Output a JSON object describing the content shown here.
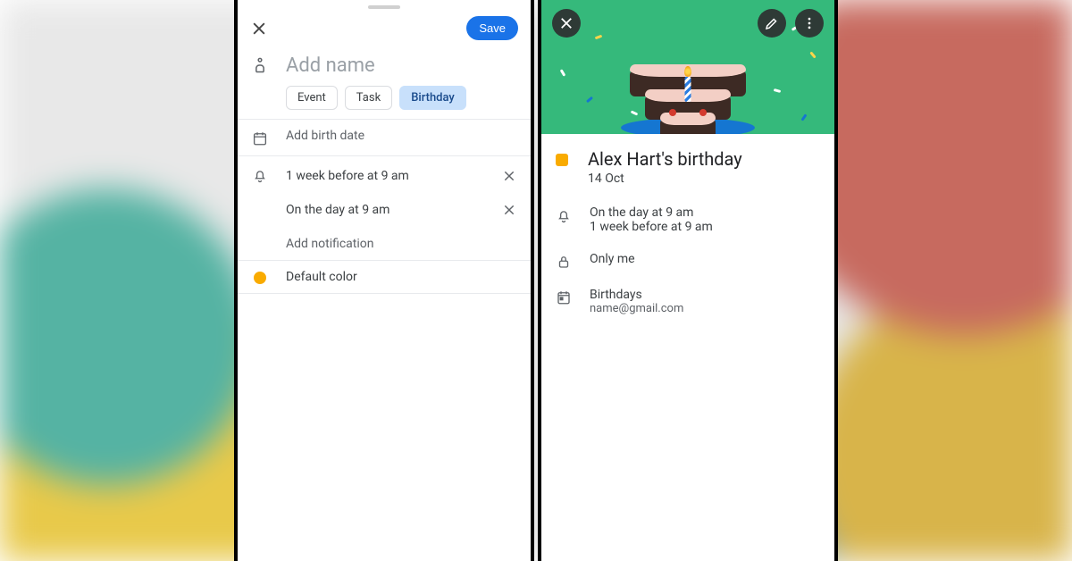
{
  "left": {
    "save": "Save",
    "name_placeholder": "Add name",
    "chips": {
      "event": "Event",
      "task": "Task",
      "birthday": "Birthday"
    },
    "birth_date": "Add birth date",
    "notif1": "1 week before at 9 am",
    "notif2": "On the day at 9 am",
    "add_notif": "Add notification",
    "color_label": "Default color"
  },
  "right": {
    "title": "Alex Hart's birthday",
    "date": "14 Oct",
    "notif_a": "On the day at 9 am",
    "notif_b": "1 week before at 9 am",
    "visibility": "Only me",
    "calendar": "Birthdays",
    "email": "name@gmail.com"
  }
}
